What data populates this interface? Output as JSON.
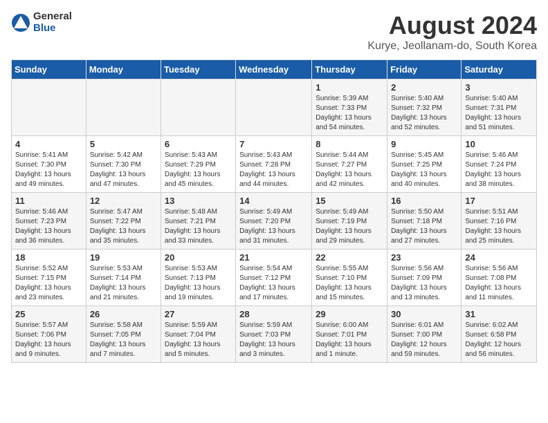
{
  "logo": {
    "general": "General",
    "blue": "Blue"
  },
  "title": "August 2024",
  "location": "Kurye, Jeollanam-do, South Korea",
  "weekdays": [
    "Sunday",
    "Monday",
    "Tuesday",
    "Wednesday",
    "Thursday",
    "Friday",
    "Saturday"
  ],
  "weeks": [
    [
      {
        "day": "",
        "info": ""
      },
      {
        "day": "",
        "info": ""
      },
      {
        "day": "",
        "info": ""
      },
      {
        "day": "",
        "info": ""
      },
      {
        "day": "1",
        "info": "Sunrise: 5:39 AM\nSunset: 7:33 PM\nDaylight: 13 hours and 54 minutes."
      },
      {
        "day": "2",
        "info": "Sunrise: 5:40 AM\nSunset: 7:32 PM\nDaylight: 13 hours and 52 minutes."
      },
      {
        "day": "3",
        "info": "Sunrise: 5:40 AM\nSunset: 7:31 PM\nDaylight: 13 hours and 51 minutes."
      }
    ],
    [
      {
        "day": "4",
        "info": "Sunrise: 5:41 AM\nSunset: 7:30 PM\nDaylight: 13 hours and 49 minutes."
      },
      {
        "day": "5",
        "info": "Sunrise: 5:42 AM\nSunset: 7:30 PM\nDaylight: 13 hours and 47 minutes."
      },
      {
        "day": "6",
        "info": "Sunrise: 5:43 AM\nSunset: 7:29 PM\nDaylight: 13 hours and 45 minutes."
      },
      {
        "day": "7",
        "info": "Sunrise: 5:43 AM\nSunset: 7:28 PM\nDaylight: 13 hours and 44 minutes."
      },
      {
        "day": "8",
        "info": "Sunrise: 5:44 AM\nSunset: 7:27 PM\nDaylight: 13 hours and 42 minutes."
      },
      {
        "day": "9",
        "info": "Sunrise: 5:45 AM\nSunset: 7:25 PM\nDaylight: 13 hours and 40 minutes."
      },
      {
        "day": "10",
        "info": "Sunrise: 5:46 AM\nSunset: 7:24 PM\nDaylight: 13 hours and 38 minutes."
      }
    ],
    [
      {
        "day": "11",
        "info": "Sunrise: 5:46 AM\nSunset: 7:23 PM\nDaylight: 13 hours and 36 minutes."
      },
      {
        "day": "12",
        "info": "Sunrise: 5:47 AM\nSunset: 7:22 PM\nDaylight: 13 hours and 35 minutes."
      },
      {
        "day": "13",
        "info": "Sunrise: 5:48 AM\nSunset: 7:21 PM\nDaylight: 13 hours and 33 minutes."
      },
      {
        "day": "14",
        "info": "Sunrise: 5:49 AM\nSunset: 7:20 PM\nDaylight: 13 hours and 31 minutes."
      },
      {
        "day": "15",
        "info": "Sunrise: 5:49 AM\nSunset: 7:19 PM\nDaylight: 13 hours and 29 minutes."
      },
      {
        "day": "16",
        "info": "Sunrise: 5:50 AM\nSunset: 7:18 PM\nDaylight: 13 hours and 27 minutes."
      },
      {
        "day": "17",
        "info": "Sunrise: 5:51 AM\nSunset: 7:16 PM\nDaylight: 13 hours and 25 minutes."
      }
    ],
    [
      {
        "day": "18",
        "info": "Sunrise: 5:52 AM\nSunset: 7:15 PM\nDaylight: 13 hours and 23 minutes."
      },
      {
        "day": "19",
        "info": "Sunrise: 5:53 AM\nSunset: 7:14 PM\nDaylight: 13 hours and 21 minutes."
      },
      {
        "day": "20",
        "info": "Sunrise: 5:53 AM\nSunset: 7:13 PM\nDaylight: 13 hours and 19 minutes."
      },
      {
        "day": "21",
        "info": "Sunrise: 5:54 AM\nSunset: 7:12 PM\nDaylight: 13 hours and 17 minutes."
      },
      {
        "day": "22",
        "info": "Sunrise: 5:55 AM\nSunset: 7:10 PM\nDaylight: 13 hours and 15 minutes."
      },
      {
        "day": "23",
        "info": "Sunrise: 5:56 AM\nSunset: 7:09 PM\nDaylight: 13 hours and 13 minutes."
      },
      {
        "day": "24",
        "info": "Sunrise: 5:56 AM\nSunset: 7:08 PM\nDaylight: 13 hours and 11 minutes."
      }
    ],
    [
      {
        "day": "25",
        "info": "Sunrise: 5:57 AM\nSunset: 7:06 PM\nDaylight: 13 hours and 9 minutes."
      },
      {
        "day": "26",
        "info": "Sunrise: 5:58 AM\nSunset: 7:05 PM\nDaylight: 13 hours and 7 minutes."
      },
      {
        "day": "27",
        "info": "Sunrise: 5:59 AM\nSunset: 7:04 PM\nDaylight: 13 hours and 5 minutes."
      },
      {
        "day": "28",
        "info": "Sunrise: 5:59 AM\nSunset: 7:03 PM\nDaylight: 13 hours and 3 minutes."
      },
      {
        "day": "29",
        "info": "Sunrise: 6:00 AM\nSunset: 7:01 PM\nDaylight: 13 hours and 1 minute."
      },
      {
        "day": "30",
        "info": "Sunrise: 6:01 AM\nSunset: 7:00 PM\nDaylight: 12 hours and 59 minutes."
      },
      {
        "day": "31",
        "info": "Sunrise: 6:02 AM\nSunset: 6:58 PM\nDaylight: 12 hours and 56 minutes."
      }
    ]
  ]
}
